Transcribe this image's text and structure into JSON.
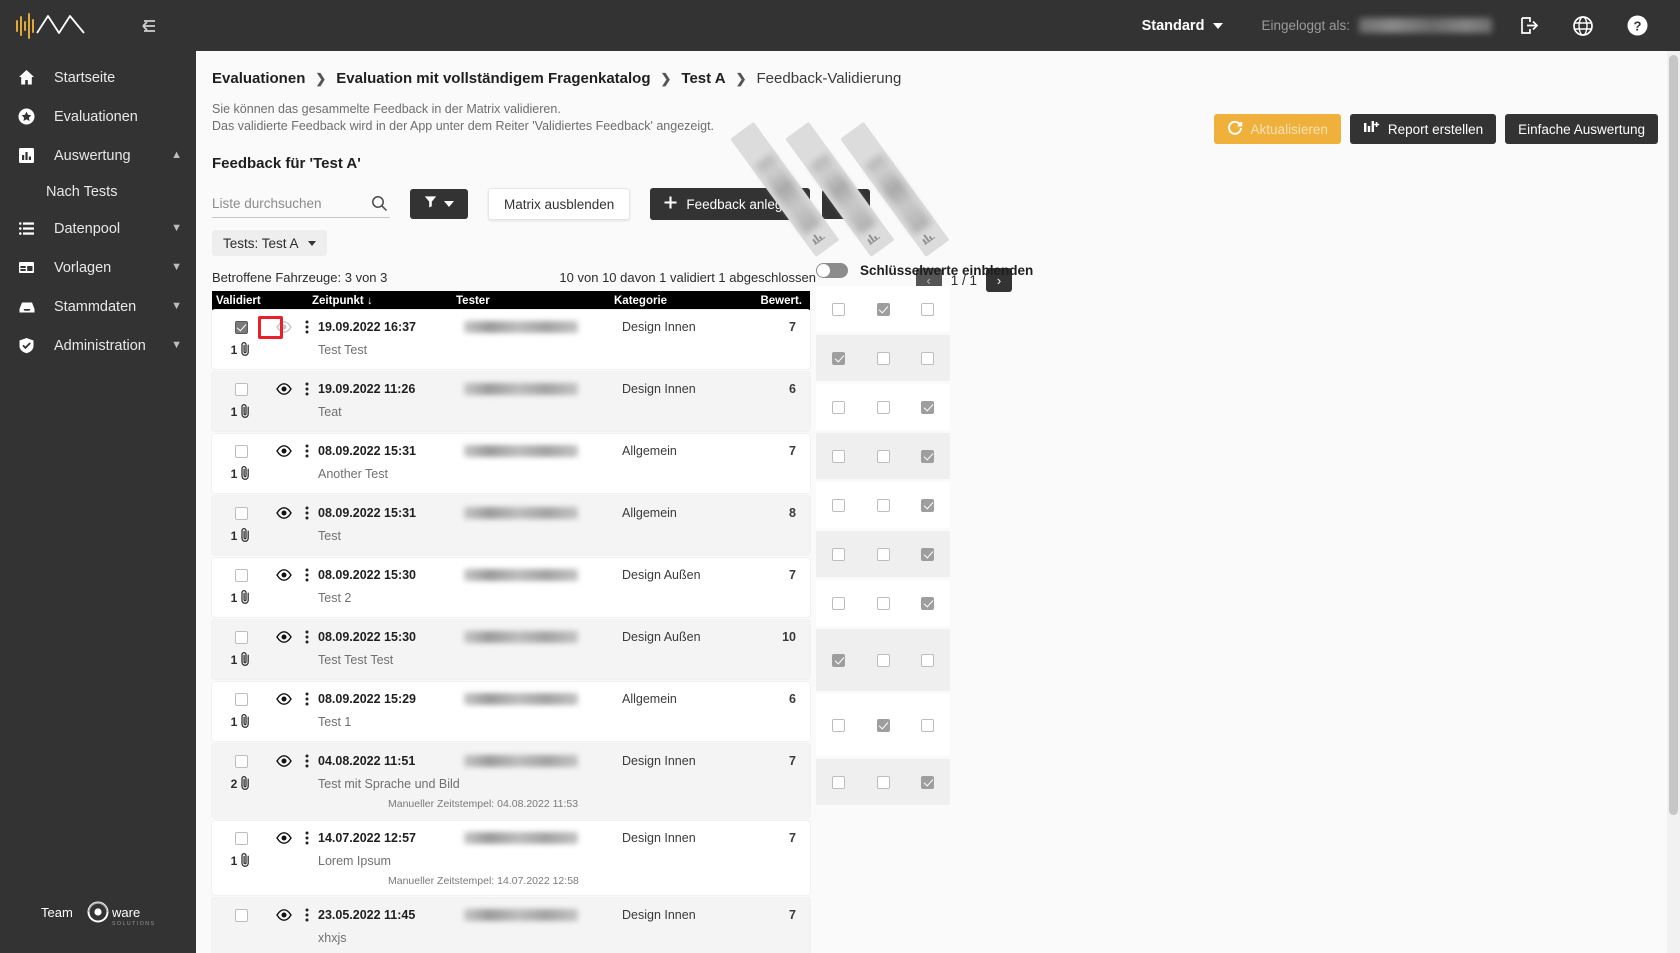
{
  "topbar": {
    "profile_select": "Standard",
    "logged_in_label": "Eingeloggt als:",
    "logged_in_user": "",
    "icons": [
      "logout-icon",
      "globe-icon",
      "help-icon"
    ]
  },
  "sidebar": {
    "items": [
      {
        "label": "Startseite",
        "icon": "home-icon",
        "expandable": false
      },
      {
        "label": "Evaluationen",
        "icon": "star-icon",
        "expandable": false
      },
      {
        "label": "Auswertung",
        "icon": "bar-chart-icon",
        "expandable": true,
        "expanded": true
      },
      {
        "label": "Datenpool",
        "icon": "list-icon",
        "expandable": true,
        "expanded": false
      },
      {
        "label": "Vorlagen",
        "icon": "template-icon",
        "expandable": true,
        "expanded": false
      },
      {
        "label": "Stammdaten",
        "icon": "inbox-icon",
        "expandable": true,
        "expanded": false
      },
      {
        "label": "Administration",
        "icon": "shield-check-icon",
        "expandable": true,
        "expanded": false
      }
    ],
    "sub_items": [
      {
        "label": "Nach Tests",
        "parent": "Auswertung"
      }
    ],
    "footer_logo": "Team ware SOLUTIONS"
  },
  "breadcrumb": [
    "Evaluationen",
    "Evaluation mit vollständigem Fragenkatalog",
    "Test A",
    "Feedback-Validierung"
  ],
  "header_actions": {
    "refresh": "Aktualisieren",
    "report": "Report erstellen",
    "simple_eval": "Einfache Auswertung"
  },
  "help_text": {
    "line1": "Sie können das gesammelte Feedback in der Matrix validieren.",
    "line2": "Das validierte Feedback wird in der App unter dem Reiter 'Validiertes Feedback' angezeigt."
  },
  "section_title": "Feedback für 'Test A'",
  "toolbar": {
    "search_placeholder": "Liste durchsuchen",
    "search_value": "",
    "filter_icon": "funnel-icon",
    "hide_matrix": "Matrix ausblenden",
    "create_feedback": "Feedback anlegen",
    "settings_icon": "gear-icon"
  },
  "filter_chip": "Tests: Test A",
  "pagination": {
    "prev": "‹",
    "next": "›",
    "page_text": "1 / 1"
  },
  "counts": {
    "vehicles": "Betroffene Fahrzeuge: 3 von 3",
    "summary": "10 von 10 davon 1 validiert 1 abgeschlossen"
  },
  "matrix": {
    "toggle_label": "Schlüsselwerte einblenden",
    "toggle_on": false,
    "columns": [
      "",
      "",
      ""
    ]
  },
  "table": {
    "headers": {
      "validiert": "Validiert",
      "zeitpunkt": "Zeitpunkt",
      "sort_arrow": "↓",
      "tester": "Tester",
      "kategorie": "Kategorie",
      "bewertung": "Bewert."
    },
    "rows": [
      {
        "validated": true,
        "highlighted": true,
        "eye_dim": true,
        "date": "19.09.2022 16:37",
        "tester": "",
        "category": "Design Innen",
        "rating": "7",
        "attachments": "1",
        "comment": "Test Test",
        "manual_ts": "",
        "matrix": [
          false,
          true,
          false
        ]
      },
      {
        "validated": false,
        "highlighted": false,
        "eye_dim": false,
        "date": "19.09.2022 11:26",
        "tester": "",
        "category": "Design Innen",
        "rating": "6",
        "attachments": "1",
        "comment": "Teat",
        "manual_ts": "",
        "matrix": [
          true,
          false,
          false
        ]
      },
      {
        "validated": false,
        "highlighted": false,
        "eye_dim": false,
        "date": "08.09.2022 15:31",
        "tester": "",
        "category": "Allgemein",
        "rating": "7",
        "attachments": "1",
        "comment": "Another Test",
        "manual_ts": "",
        "matrix": [
          false,
          false,
          true
        ]
      },
      {
        "validated": false,
        "highlighted": false,
        "eye_dim": false,
        "date": "08.09.2022 15:31",
        "tester": "",
        "category": "Allgemein",
        "rating": "8",
        "attachments": "1",
        "comment": "Test",
        "manual_ts": "",
        "matrix": [
          false,
          false,
          true
        ]
      },
      {
        "validated": false,
        "highlighted": false,
        "eye_dim": false,
        "date": "08.09.2022 15:30",
        "tester": "",
        "category": "Design Außen",
        "rating": "7",
        "attachments": "1",
        "comment": "Test 2",
        "manual_ts": "",
        "matrix": [
          false,
          false,
          true
        ]
      },
      {
        "validated": false,
        "highlighted": false,
        "eye_dim": false,
        "date": "08.09.2022 15:30",
        "tester": "",
        "category": "Design Außen",
        "rating": "10",
        "attachments": "1",
        "comment": "Test Test Test",
        "manual_ts": "",
        "matrix": [
          false,
          false,
          true
        ]
      },
      {
        "validated": false,
        "highlighted": false,
        "eye_dim": false,
        "date": "08.09.2022 15:29",
        "tester": "",
        "category": "Allgemein",
        "rating": "6",
        "attachments": "1",
        "comment": "Test 1",
        "manual_ts": "",
        "matrix": [
          false,
          false,
          true
        ]
      },
      {
        "validated": false,
        "highlighted": false,
        "eye_dim": false,
        "date": "04.08.2022 11:51",
        "tester": "",
        "category": "Design Innen",
        "rating": "7",
        "attachments": "2",
        "comment": "Test mit Sprache und Bild",
        "manual_ts": "Manueller Zeitstempel: 04.08.2022 11:53",
        "matrix": [
          true,
          false,
          false
        ]
      },
      {
        "validated": false,
        "highlighted": false,
        "eye_dim": false,
        "date": "14.07.2022 12:57",
        "tester": "",
        "category": "Design Innen",
        "rating": "7",
        "attachments": "1",
        "comment": "Lorem Ipsum",
        "manual_ts": "Manueller Zeitstempel: 14.07.2022 12:58",
        "matrix": [
          false,
          true,
          false
        ]
      },
      {
        "validated": false,
        "highlighted": false,
        "eye_dim": false,
        "date": "23.05.2022 11:45",
        "tester": "",
        "category": "Design Innen",
        "rating": "7",
        "attachments": "",
        "comment": "xhxjs",
        "manual_ts": "",
        "matrix": [
          false,
          false,
          true
        ]
      }
    ]
  },
  "colors": {
    "sidebar_bg": "#333333",
    "accent_amber": "#efb13c",
    "highlight_red": "#e8202a",
    "table_header_bg": "#000000"
  }
}
